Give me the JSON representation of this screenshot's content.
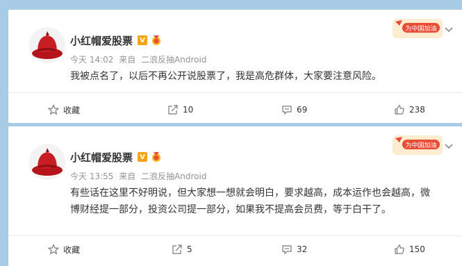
{
  "posts": [
    {
      "author": "小红帽爱股票",
      "verified_badge": "V",
      "time": "今天 14:02",
      "source_prefix": "来自",
      "source": "二浪反抽Android",
      "text": "我被点名了，以后不再公开说股票了，我是高危群体，大家要注意风险。",
      "campaign_badge": "为中国加油",
      "actions": {
        "favorite_label": "收藏",
        "repost_count": "10",
        "comment_count": "69",
        "like_count": "238"
      }
    },
    {
      "author": "小红帽爱股票",
      "verified_badge": "V",
      "time": "今天 13:55",
      "source_prefix": "来自",
      "source": "二浪反抽Android",
      "text": "有些话在这里不好明说，但大家想一想就会明白，要求越高，成本运作也会越高，微博财经提一部分，投资公司提一部分，如果我不提高会员费，等于白干了。",
      "campaign_badge": "为中国加油",
      "actions": {
        "favorite_label": "收藏",
        "repost_count": "5",
        "comment_count": "32",
        "like_count": "150"
      }
    }
  ],
  "icons": {
    "favorite": "star-outline-icon",
    "repost": "repost-arrow-icon",
    "comment": "comment-bubble-icon",
    "like": "thumbs-up-icon",
    "expand": "chevron-down-icon"
  },
  "colors": {
    "page_background": "#a8cbe6",
    "verified_badge": "#f2a316",
    "campaign_badge": "#e94b35",
    "meta_text": "#939393"
  }
}
